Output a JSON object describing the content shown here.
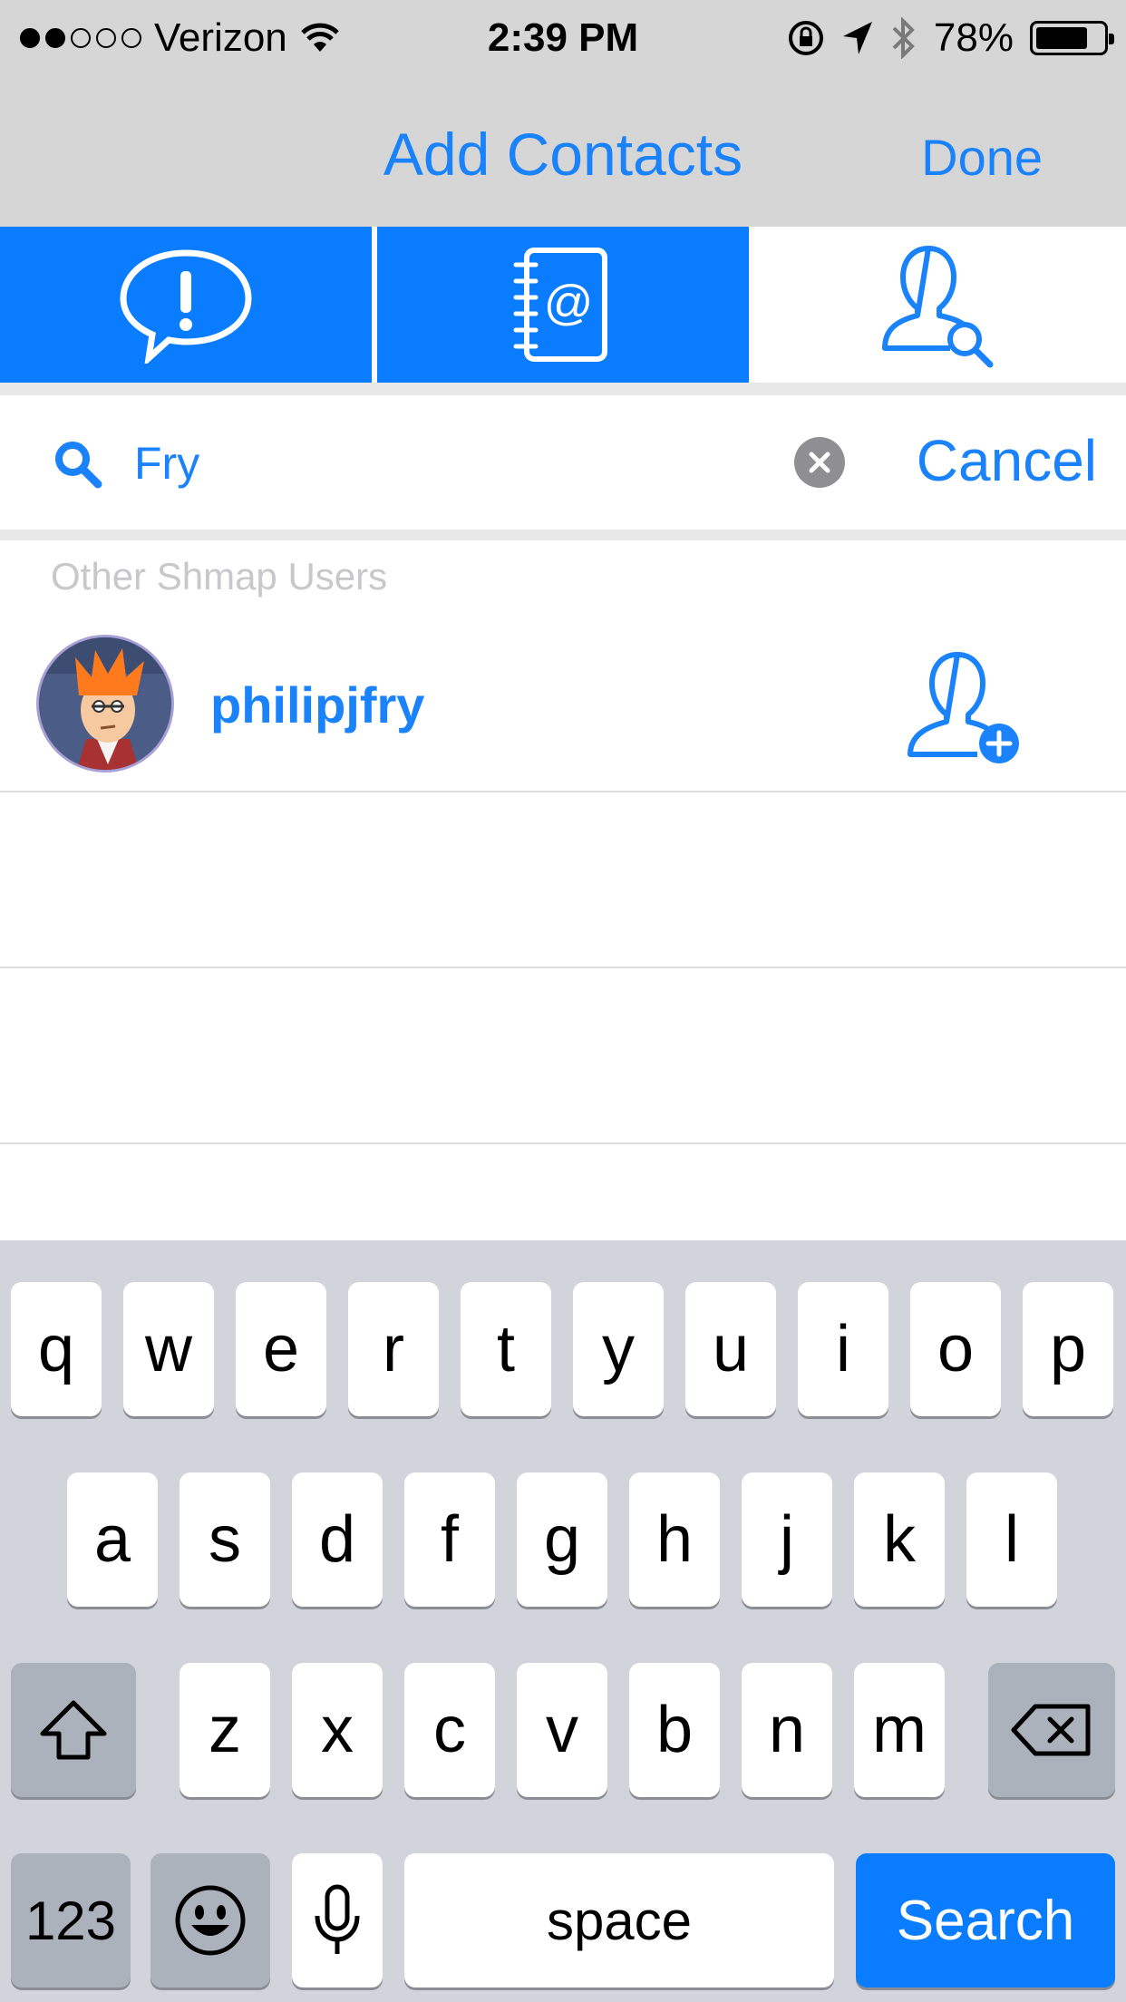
{
  "status_bar": {
    "carrier": "Verizon",
    "time": "2:39 PM",
    "battery": "78%",
    "signal_bars_filled": 2,
    "signal_bars_total": 5,
    "battery_level": 0.78
  },
  "nav": {
    "title": "Add Contacts",
    "done_label": "Done"
  },
  "tabs": [
    {
      "name": "alerts",
      "icon": "speech-bubble-exclamation-icon",
      "active": true
    },
    {
      "name": "address-book",
      "icon": "address-book-icon",
      "active": true
    },
    {
      "name": "search-users",
      "icon": "user-search-icon",
      "active": false
    }
  ],
  "search": {
    "value": "Fry",
    "placeholder": "",
    "cancel_label": "Cancel"
  },
  "results": {
    "section_title": "Other Shmap Users",
    "users": [
      {
        "username": "philipjfry",
        "action_icon": "add-user-icon"
      }
    ]
  },
  "keyboard": {
    "row1": [
      "q",
      "w",
      "e",
      "r",
      "t",
      "y",
      "u",
      "i",
      "o",
      "p"
    ],
    "row2": [
      "a",
      "s",
      "d",
      "f",
      "g",
      "h",
      "j",
      "k",
      "l"
    ],
    "row3": [
      "z",
      "x",
      "c",
      "v",
      "b",
      "n",
      "m"
    ],
    "numbers_label": "123",
    "space_label": "space",
    "search_label": "Search"
  },
  "colors": {
    "accent": "#1a82fb",
    "tab_active": "#0a7cff",
    "nav_bg": "#d6d6d6",
    "keyboard_bg": "#d1d4da"
  }
}
